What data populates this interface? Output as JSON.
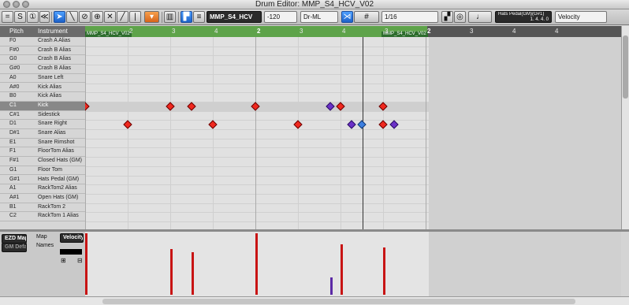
{
  "window": {
    "title": "Drum Editor: MMP_S4_HCV_V02"
  },
  "toolbar": {
    "part_name": "MMP_S4_HCV",
    "transpose": "-120",
    "drum_map": "Dr-ML",
    "quantize": "1/16",
    "pedal_label": "Hats Pedal(GM)(G#1)",
    "position": "1.  4.  4.    0",
    "controller_lane": "Velocity",
    "accent_color": "#1d62c9"
  },
  "header": {
    "pitch": "Pitch",
    "instrument": "Instrument"
  },
  "ruler": {
    "ticks": [
      "2",
      "3",
      "4",
      "2",
      "3",
      "4",
      "3",
      "2",
      "3",
      "4",
      "4"
    ],
    "part_tag": "MMP_S4_HCV_V02",
    "part_tag_2": "MMP_S4_HCV_V02"
  },
  "drums": [
    {
      "pitch": "F0",
      "name": "Crash A Alias"
    },
    {
      "pitch": "F#0",
      "name": "Crash B Alias"
    },
    {
      "pitch": "G0",
      "name": "Crash B Alias"
    },
    {
      "pitch": "G#0",
      "name": "Crash B Alias"
    },
    {
      "pitch": "A0",
      "name": "Snare Left"
    },
    {
      "pitch": "A#0",
      "name": "Kick Alias"
    },
    {
      "pitch": "B0",
      "name": "Kick Alias"
    },
    {
      "pitch": "C1",
      "name": "Kick"
    },
    {
      "pitch": "C#1",
      "name": "Sidestick"
    },
    {
      "pitch": "D1",
      "name": "Snare Right"
    },
    {
      "pitch": "D#1",
      "name": "Snare Alias"
    },
    {
      "pitch": "E1",
      "name": "Snare Rimshot"
    },
    {
      "pitch": "F1",
      "name": "FloorTom Alias"
    },
    {
      "pitch": "F#1",
      "name": "Closed Hats (GM)"
    },
    {
      "pitch": "G1",
      "name": "Floor Tom"
    },
    {
      "pitch": "G#1",
      "name": "Hats Pedal (GM)"
    },
    {
      "pitch": "A1",
      "name": "RackTom2 Alias"
    },
    {
      "pitch": "A#1",
      "name": "Open Hats (GM)"
    },
    {
      "pitch": "B1",
      "name": "RackTom 2"
    },
    {
      "pitch": "C2",
      "name": "RackTom 1 Alias"
    }
  ],
  "lower_panel": {
    "map_label": "Map",
    "map_value": "EZD Map",
    "names_label": "Names",
    "names_value": "GM Default",
    "lane_select": "Velocity"
  },
  "notes": [
    {
      "row": 7,
      "beat": 0.0,
      "color": "red"
    },
    {
      "row": 7,
      "beat": 2.0,
      "color": "red"
    },
    {
      "row": 7,
      "beat": 2.5,
      "color": "red"
    },
    {
      "row": 7,
      "beat": 4.0,
      "color": "red"
    },
    {
      "row": 7,
      "beat": 5.75,
      "color": "purple"
    },
    {
      "row": 7,
      "beat": 6.0,
      "color": "red"
    },
    {
      "row": 7,
      "beat": 7.0,
      "color": "red"
    },
    {
      "row": 9,
      "beat": 1.0,
      "color": "red"
    },
    {
      "row": 9,
      "beat": 3.0,
      "color": "red"
    },
    {
      "row": 9,
      "beat": 5.0,
      "color": "red"
    },
    {
      "row": 9,
      "beat": 6.25,
      "color": "purple"
    },
    {
      "row": 9,
      "beat": 6.5,
      "color": "blue"
    },
    {
      "row": 9,
      "beat": 7.0,
      "color": "red"
    },
    {
      "row": 9,
      "beat": 7.25,
      "color": "purple"
    }
  ],
  "velocities": [
    {
      "beat": 0.0,
      "value": 127,
      "color": "red"
    },
    {
      "beat": 2.0,
      "value": 95,
      "color": "red"
    },
    {
      "beat": 2.5,
      "value": 88,
      "color": "red"
    },
    {
      "beat": 4.0,
      "value": 127,
      "color": "red"
    },
    {
      "beat": 5.75,
      "value": 36,
      "color": "purple"
    },
    {
      "beat": 6.0,
      "value": 105,
      "color": "red"
    },
    {
      "beat": 7.0,
      "value": 97,
      "color": "red"
    }
  ]
}
